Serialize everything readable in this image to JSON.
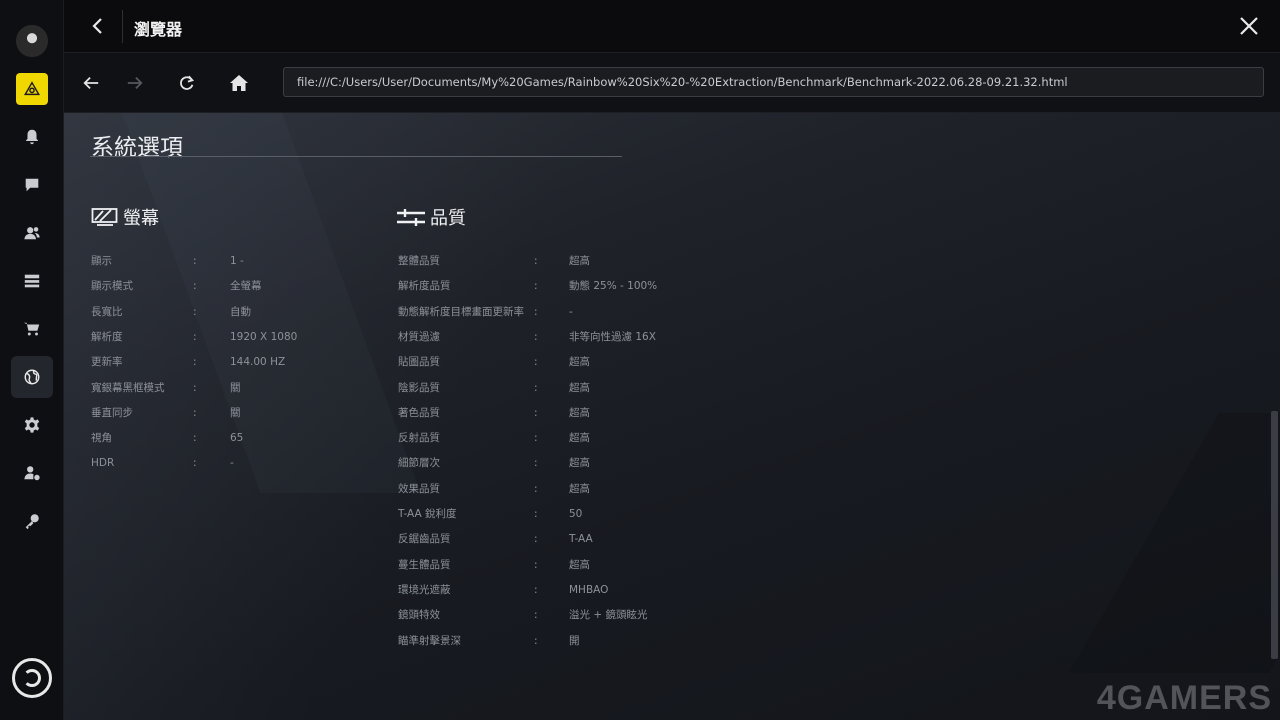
{
  "window": {
    "title": "瀏覽器"
  },
  "browser": {
    "url": "file:///C:/Users/User/Documents/My%20Games/Rainbow%20Six%20-%20Extraction/Benchmark/Benchmark-2022.06.28-09.21.32.html"
  },
  "sidebar": {
    "items": [
      {
        "icon": "bell-icon"
      },
      {
        "icon": "chat-icon"
      },
      {
        "icon": "friends-icon"
      },
      {
        "icon": "library-icon"
      },
      {
        "icon": "cart-icon"
      },
      {
        "icon": "globe-icon"
      },
      {
        "icon": "gear-icon"
      },
      {
        "icon": "account-settings-icon"
      },
      {
        "icon": "key-icon"
      }
    ],
    "brand_color": "#f0d700"
  },
  "page": {
    "title": "系統選項",
    "display": {
      "heading": "螢幕",
      "rows": [
        {
          "label": "顯示",
          "value": "1 -"
        },
        {
          "label": "顯示模式",
          "value": "全螢幕"
        },
        {
          "label": "長寬比",
          "value": "自動"
        },
        {
          "label": "解析度",
          "value": "1920 X 1080"
        },
        {
          "label": "更新率",
          "value": "144.00 HZ"
        },
        {
          "label": "寬銀幕黑框模式",
          "value": "關"
        },
        {
          "label": "垂直同步",
          "value": "關"
        },
        {
          "label": "視角",
          "value": "65"
        },
        {
          "label": "HDR",
          "value": "-"
        }
      ]
    },
    "quality": {
      "heading": "品質",
      "rows": [
        {
          "label": "整體品質",
          "value": "超高"
        },
        {
          "label": "解析度品質",
          "value": "動態 25% - 100%"
        },
        {
          "label": "動態解析度目標畫面更新率",
          "value": "-"
        },
        {
          "label": "材質過濾",
          "value": "非等向性過濾 16X"
        },
        {
          "label": "貼圖品質",
          "value": "超高"
        },
        {
          "label": "陰影品質",
          "value": "超高"
        },
        {
          "label": "著色品質",
          "value": "超高"
        },
        {
          "label": "反射品質",
          "value": "超高"
        },
        {
          "label": "細節層次",
          "value": "超高"
        },
        {
          "label": "效果品質",
          "value": "超高"
        },
        {
          "label": "T-AA 銳利度",
          "value": "50"
        },
        {
          "label": "反鋸齒品質",
          "value": "T-AA"
        },
        {
          "label": "蔓生體品質",
          "value": "超高"
        },
        {
          "label": "環境光遮蔽",
          "value": "MHBAO"
        },
        {
          "label": "鏡頭特效",
          "value": "溢光 + 鏡頭眩光"
        },
        {
          "label": "瞄準射擊景深",
          "value": "開"
        }
      ]
    }
  },
  "watermark": "4GAMERS"
}
